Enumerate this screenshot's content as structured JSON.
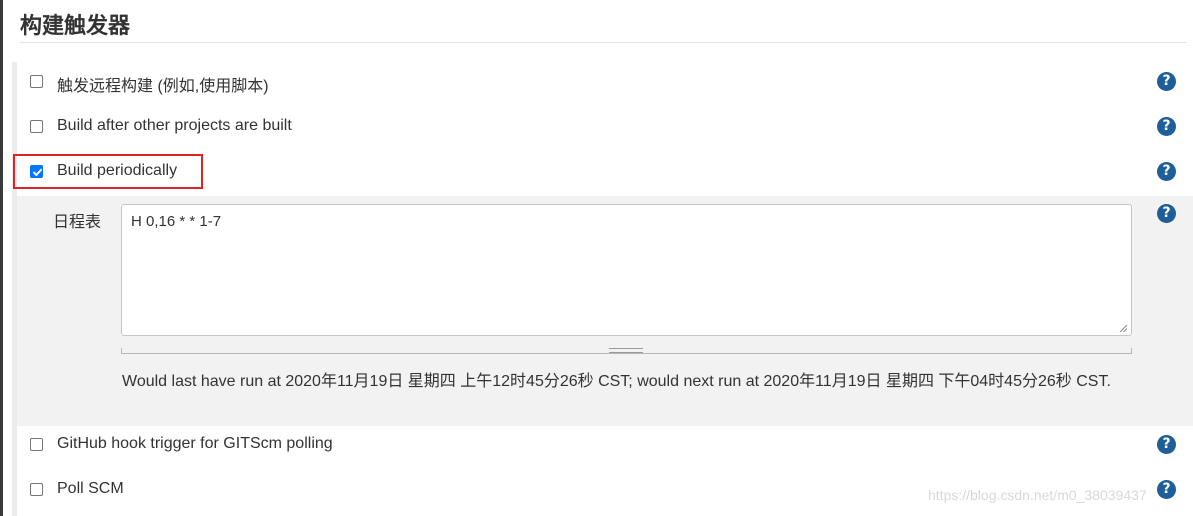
{
  "section": {
    "title": "构建触发器"
  },
  "triggers": [
    {
      "label": "触发远程构建 (例如,使用脚本)",
      "checked": false,
      "help": "?"
    },
    {
      "label": "Build after other projects are built",
      "checked": false,
      "help": "?"
    },
    {
      "label": "Build periodically",
      "checked": true,
      "help": "?"
    },
    {
      "label": "GitHub hook trigger for GITScm polling",
      "checked": false,
      "help": "?"
    },
    {
      "label": "Poll SCM",
      "checked": false,
      "help": "?"
    }
  ],
  "schedule": {
    "label": "日程表",
    "value": "H 0,16 * * 1-7",
    "help": "?",
    "note": "Would last have run at 2020年11月19日 星期四 上午12时45分26秒 CST; would next run at 2020年11月19日 星期四 下午04时45分26秒 CST."
  },
  "watermark": "https://blog.csdn.net/m0_38039437",
  "colors": {
    "checkbox_checked": "#0075ff",
    "help_icon": "#1f5f99",
    "highlight": "#e02424"
  }
}
